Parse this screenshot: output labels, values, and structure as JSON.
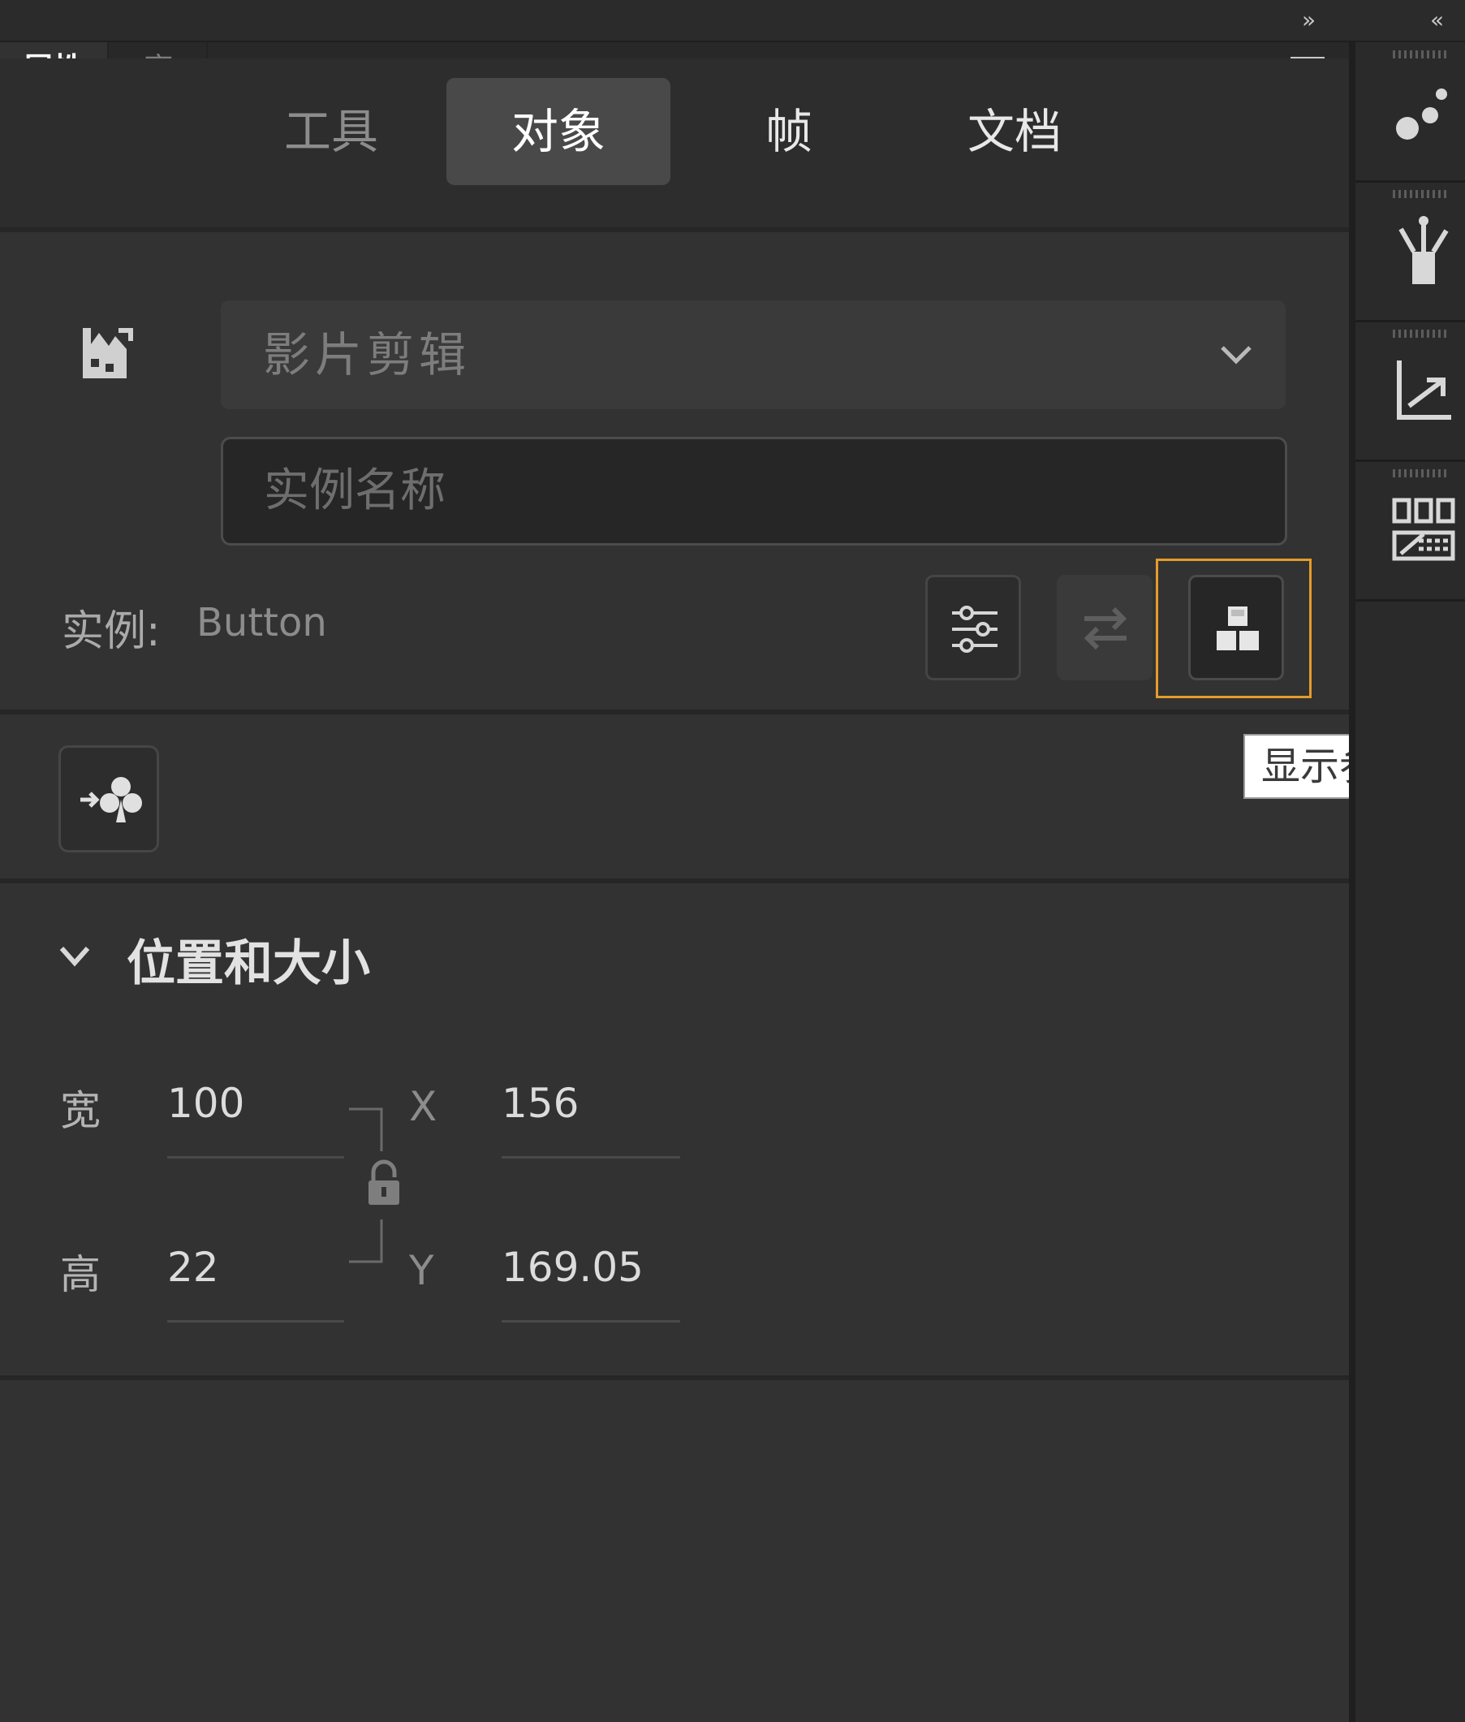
{
  "topbar": {
    "expand_icon": "»",
    "collapse_icon": "«"
  },
  "panel_tabs": {
    "properties": "属性",
    "library": "库"
  },
  "segmented_tabs": [
    {
      "label": "工具",
      "active": false,
      "color": "#8c8c8c"
    },
    {
      "label": "对象",
      "active": true,
      "color": "#ffffff"
    },
    {
      "label": "帧",
      "active": false,
      "color": "#e8e8e8"
    },
    {
      "label": "文档",
      "active": false,
      "color": "#e8e8e8"
    }
  ],
  "object": {
    "type_dropdown": {
      "value": "影片剪辑"
    },
    "instance_name": {
      "placeholder": "实例名称"
    },
    "instance_label": "实例:",
    "instance_value": "Button"
  },
  "tooltip": {
    "text": "显示参数"
  },
  "position_size": {
    "title": "位置和大小",
    "width": {
      "label": "宽",
      "value": "100"
    },
    "height": {
      "label": "高",
      "value": "22"
    },
    "x": {
      "label": "X",
      "value": "156"
    },
    "y": {
      "label": "Y",
      "value": "169.05"
    }
  },
  "dock": [
    "motion-presets-icon",
    "brush-library-icon",
    "motion-editor-icon",
    "components-icon"
  ],
  "colors": {
    "focus": "#e49c2a",
    "panel_bg": "#323232",
    "dock_bg": "#2a2a2a"
  }
}
